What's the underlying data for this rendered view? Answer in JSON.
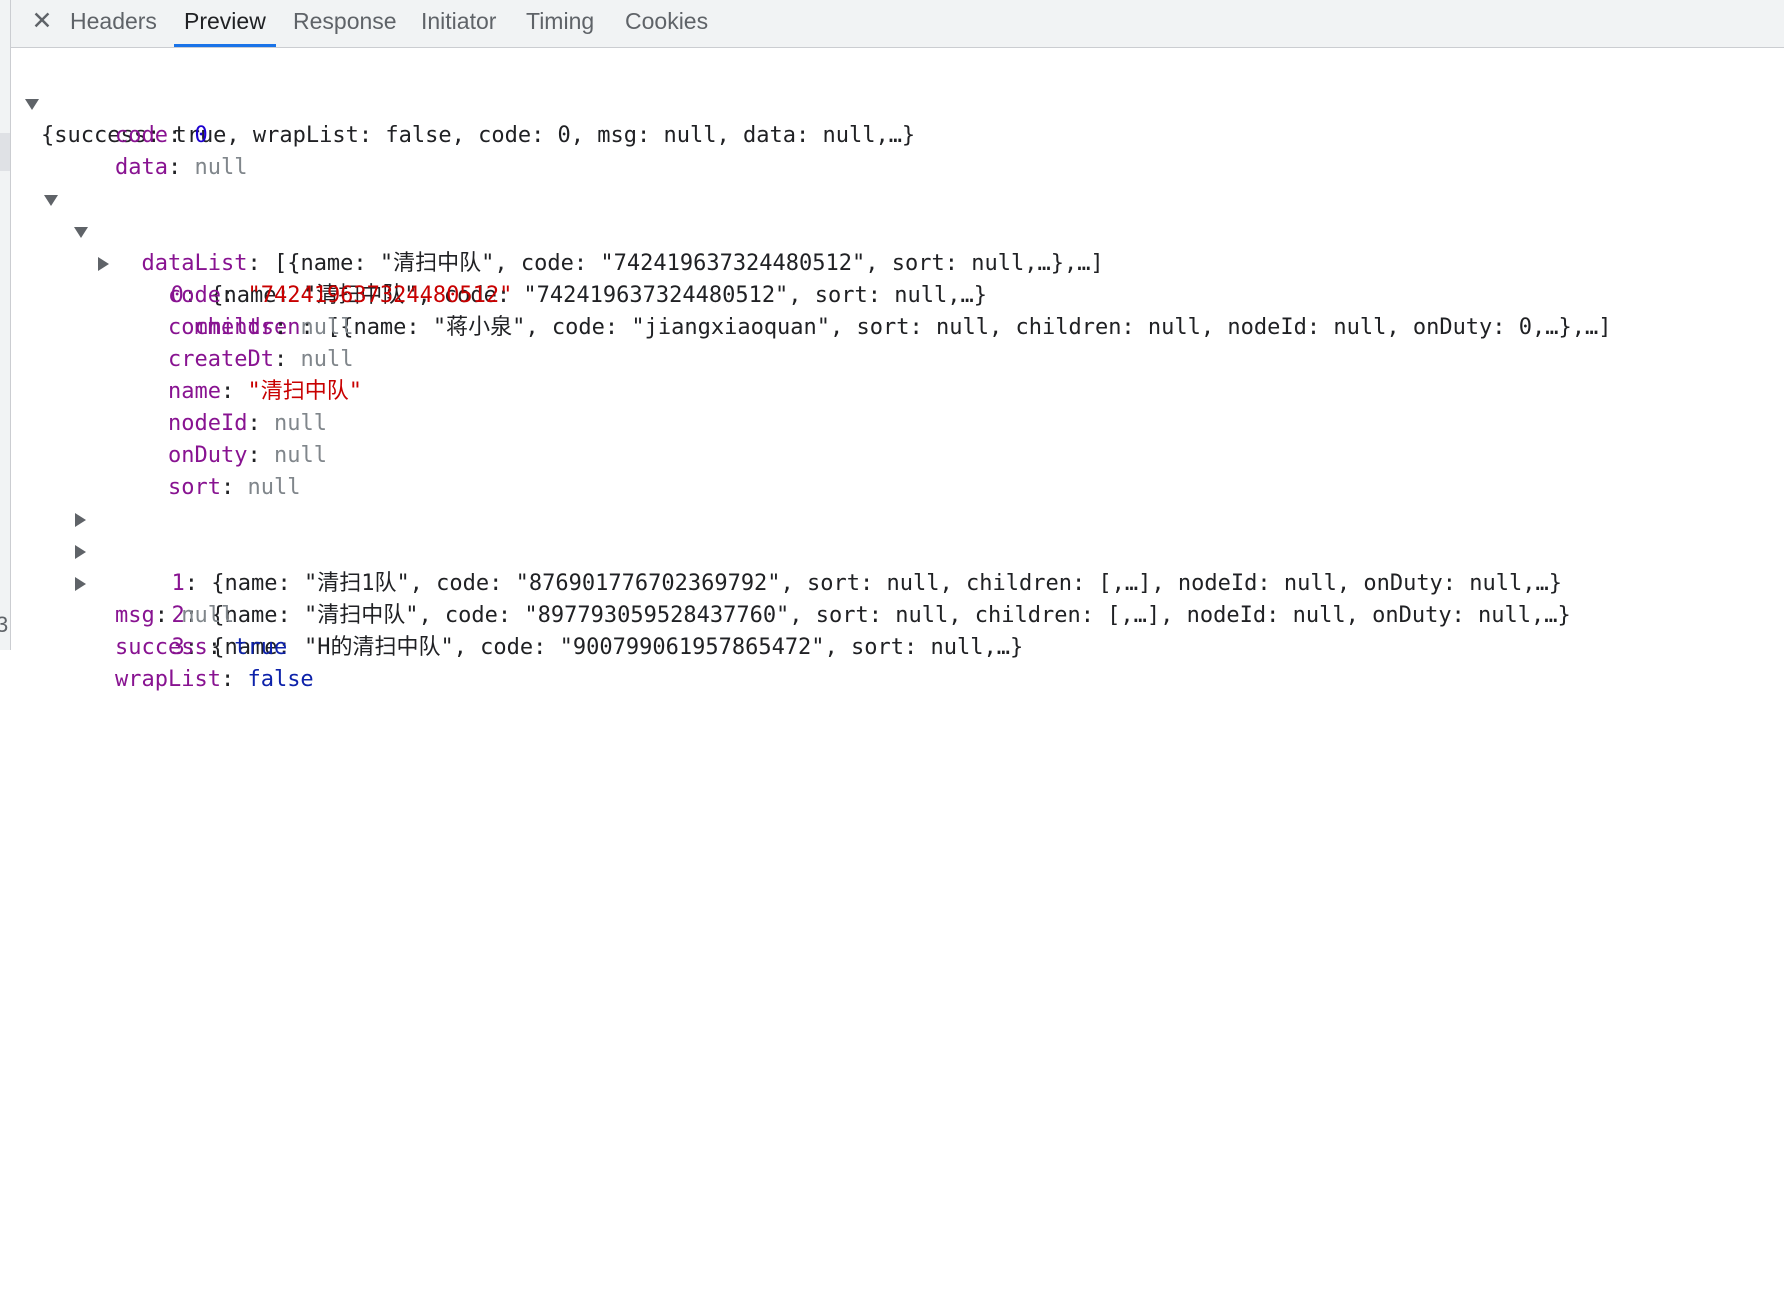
{
  "tabs": {
    "close_glyph": "✕",
    "items": [
      "Headers",
      "Preview",
      "Response",
      "Initiator",
      "Timing",
      "Cookies"
    ],
    "active": "Preview"
  },
  "preview": {
    "root_summary": "{success: true, wrapList: false, code: 0, msg: null, data: null,…}",
    "code_key": "code",
    "code_value": "0",
    "data_key": "data",
    "data_value": "null",
    "dataList_key": "dataList",
    "dataList_summary": "[{name: \"清扫中队\", code: \"742419637324480512\", sort: null,…},…]",
    "item0_key": "0",
    "item0_summary": "{name: \"清扫中队\", code: \"742419637324480512\", sort: null,…}",
    "children_key": "children",
    "children_summary": "[{name: \"蒋小泉\", code: \"jiangxiaoquan\", sort: null, children: null, nodeId: null, onDuty: 0,…},…]",
    "item0_code_key": "code",
    "item0_code_value": "\"742419637324480512\"",
    "comments_key": "comments",
    "comments_value": "null",
    "createDt_key": "createDt",
    "createDt_value": "null",
    "name_key": "name",
    "name_value": "\"清扫中队\"",
    "nodeId_key": "nodeId",
    "nodeId_value": "null",
    "onDuty_key": "onDuty",
    "onDuty_value": "null",
    "sort_key": "sort",
    "sort_value": "null",
    "item1_key": "1",
    "item1_summary": "{name: \"清扫1队\", code: \"876901776702369792\", sort: null, children: [,…], nodeId: null, onDuty: null,…}",
    "item2_key": "2",
    "item2_summary": "{name: \"清扫中队\", code: \"897793059528437760\", sort: null, children: [,…], nodeId: null, onDuty: null,…}",
    "item3_key": "3",
    "item3_summary": "{name: \"H的清扫中队\", code: \"900799061957865472\", sort: null,…}",
    "msg_key": "msg",
    "msg_value": "null",
    "success_key": "success",
    "success_value": "true",
    "wrapList_key": "wrapList",
    "wrapList_value": "false"
  },
  "gutter": {
    "char": "3"
  }
}
